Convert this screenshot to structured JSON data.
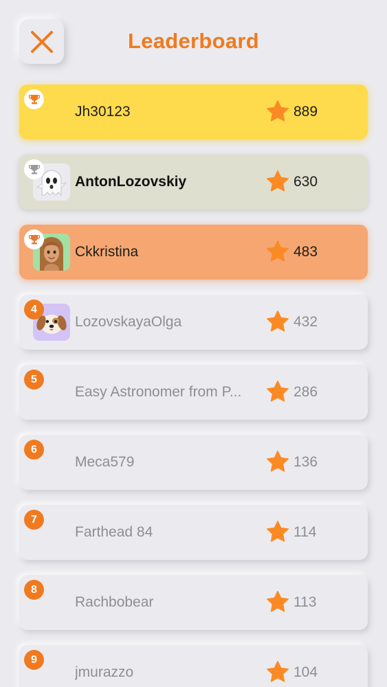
{
  "header": {
    "title": "Leaderboard",
    "close_icon": "close-x-icon"
  },
  "colors": {
    "accent": "#f07a1f",
    "background": "#ebebef",
    "gold": "#fedb4d",
    "silver": "#dfdfd0",
    "bronze": "#f6a670",
    "star": "#fc8a24"
  },
  "entries": [
    {
      "rank": "1",
      "name": "Jh30123",
      "score": "889",
      "tier": "gold",
      "badge_icon": "trophy-icon",
      "avatar_icon": ""
    },
    {
      "rank": "2",
      "name": "AntonLozovskiy",
      "score": "630",
      "tier": "silver",
      "badge_icon": "trophy-icon",
      "avatar_icon": "ghost-avatar-icon"
    },
    {
      "rank": "3",
      "name": "Ckkristina",
      "score": "483",
      "tier": "bronze",
      "badge_icon": "trophy-icon",
      "avatar_icon": "woman-avatar-icon"
    },
    {
      "rank": "4",
      "name": "LozovskayaOlga",
      "score": "432",
      "tier": "",
      "badge_icon": "",
      "avatar_icon": "dog-avatar-icon"
    },
    {
      "rank": "5",
      "name": "Easy Astronomer from P...",
      "score": "286",
      "tier": "",
      "badge_icon": "",
      "avatar_icon": ""
    },
    {
      "rank": "6",
      "name": "Meca579",
      "score": "136",
      "tier": "",
      "badge_icon": "",
      "avatar_icon": ""
    },
    {
      "rank": "7",
      "name": "Farthead 84",
      "score": "114",
      "tier": "",
      "badge_icon": "",
      "avatar_icon": ""
    },
    {
      "rank": "8",
      "name": "Rachbobear",
      "score": "113",
      "tier": "",
      "badge_icon": "",
      "avatar_icon": ""
    },
    {
      "rank": "9",
      "name": "jmurazzo",
      "score": "104",
      "tier": "",
      "badge_icon": "",
      "avatar_icon": ""
    }
  ],
  "score_icon": "star-icon"
}
